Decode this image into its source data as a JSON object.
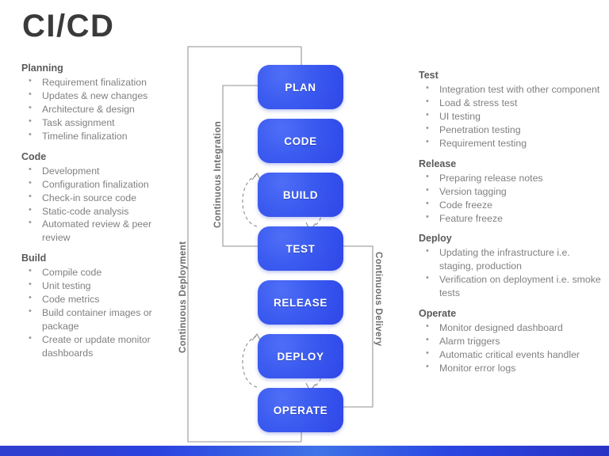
{
  "title": "CI/CD",
  "left_column": [
    {
      "heading": "Planning",
      "items": [
        "Requirement finalization",
        "Updates & new changes",
        "Architecture & design",
        "Task assignment",
        "Timeline finalization"
      ]
    },
    {
      "heading": "Code",
      "items": [
        "Development",
        "Configuration finalization",
        "Check-in source code",
        "Static-code analysis",
        "Automated review & peer review"
      ]
    },
    {
      "heading": "Build",
      "items": [
        "Compile code",
        "Unit testing",
        "Code metrics",
        "Build container images or package",
        "Create or update monitor dashboards"
      ]
    }
  ],
  "right_column": [
    {
      "heading": "Test",
      "items": [
        "Integration test with other component",
        "Load & stress test",
        "UI testing",
        "Penetration testing",
        "Requirement testing"
      ]
    },
    {
      "heading": "Release",
      "items": [
        "Preparing release notes",
        "Version tagging",
        "Code freeze",
        "Feature freeze"
      ]
    },
    {
      "heading": "Deploy",
      "items": [
        "Updating the infrastructure i.e. staging, production",
        "Verification on deployment i.e. smoke tests"
      ]
    },
    {
      "heading": "Operate",
      "items": [
        "Monitor designed dashboard",
        "Alarm triggers",
        "Automatic critical events handler",
        "Monitor error logs"
      ]
    }
  ],
  "diagram": {
    "stages": [
      {
        "label": "PLAN"
      },
      {
        "label": "CODE"
      },
      {
        "label": "BUILD"
      },
      {
        "label": "TEST"
      },
      {
        "label": "RELEASE"
      },
      {
        "label": "DEPLOY"
      },
      {
        "label": "OPERATE"
      }
    ],
    "loops": [
      {
        "label": "Continuous Deployment",
        "direction": "bottom-to-top"
      },
      {
        "label": "Continuous Integration",
        "direction": "bottom-to-top"
      },
      {
        "label": "Continuous Delivery",
        "direction": "top-to-bottom"
      }
    ],
    "feedback_arcs": [
      {
        "from": "BUILD",
        "to": "CODE",
        "style": "dashed"
      },
      {
        "from": "CODE",
        "to": "BUILD",
        "style": "dashed"
      },
      {
        "from": "DEPLOY",
        "to": "RELEASE",
        "style": "dashed"
      },
      {
        "from": "RELEASE",
        "to": "DEPLOY",
        "style": "dashed"
      }
    ]
  },
  "colors": {
    "stage_fill": "#3b5bf0",
    "stage_text": "#ffffff",
    "body_text": "#808080",
    "heading_text": "#5a5a5a",
    "title_text": "#3a3a3a",
    "connector": "#a6a6a6",
    "accent_bar": "#2f3fd0"
  }
}
